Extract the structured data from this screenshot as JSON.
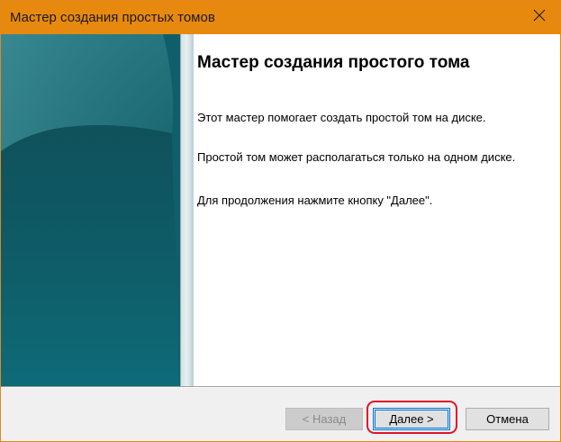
{
  "window": {
    "title": "Мастер создания простых томов",
    "close_symbol": "✕"
  },
  "main": {
    "heading": "Мастер создания простого тома",
    "paragraphs": [
      "Этот мастер помогает создать простой том на диске.",
      "Простой том может располагаться только на одном диске.",
      "Для продолжения нажмите кнопку \"Далее\"."
    ]
  },
  "footer": {
    "back_label": "< Назад",
    "next_label": "Далее >",
    "cancel_label": "Отмена"
  },
  "colors": {
    "titlebar": "#e8890f",
    "side_panel_dark": "#0f5560",
    "side_panel_light": "#2a8290",
    "highlight": "#e0142a"
  },
  "icons": {
    "close": "close-icon",
    "side_graphic": "wizard-banner-graphic"
  }
}
